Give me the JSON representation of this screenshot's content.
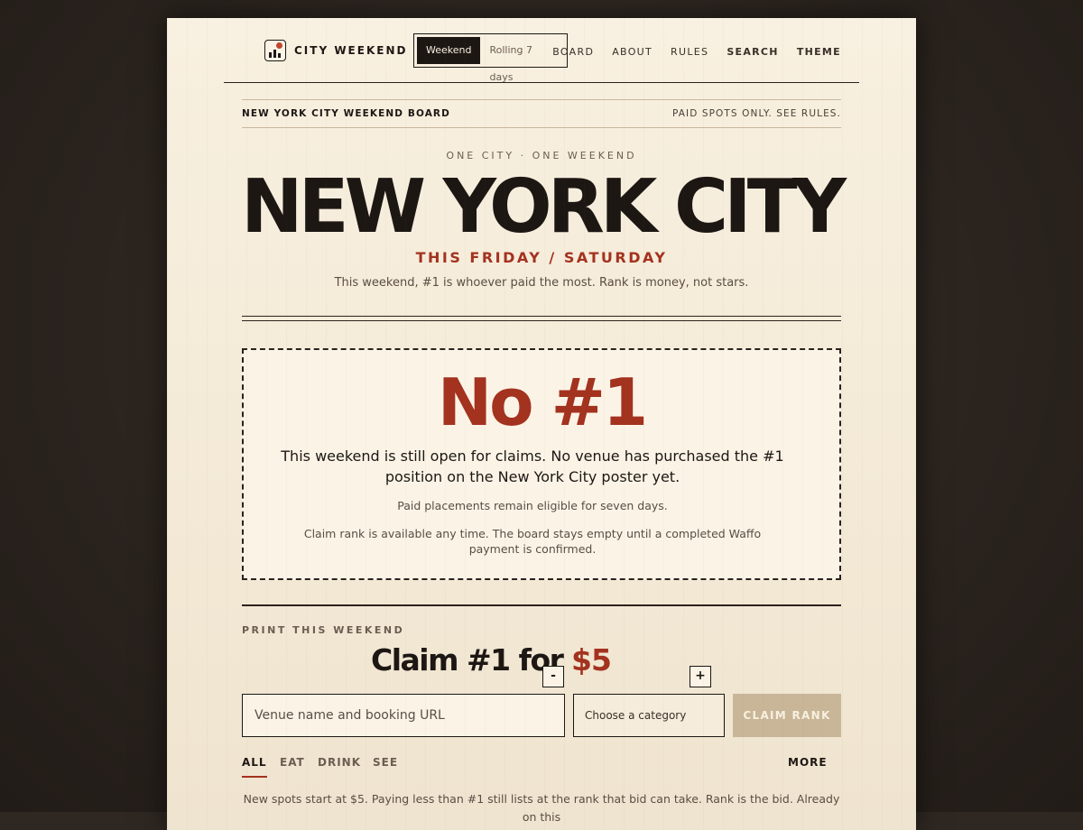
{
  "brand": {
    "name": "CITY WEEKEND",
    "logo_icon": "skyline-logo-icon"
  },
  "view_toggle": {
    "options": [
      "Weekend",
      "Rolling 7 days"
    ],
    "selected": "Weekend"
  },
  "nav": {
    "board": "BOARD",
    "about": "ABOUT",
    "rules": "RULES",
    "search": "SEARCH",
    "theme": "THEME"
  },
  "ribbon": {
    "left": "NEW YORK CITY WEEKEND BOARD",
    "right": "PAID SPOTS ONLY. SEE RULES."
  },
  "hero": {
    "kicker": "ONE CITY · ONE WEEKEND",
    "city": "NEW YORK CITY",
    "dates": "THIS FRIDAY / SATURDAY",
    "tagline": "This weekend, #1 is whoever paid the most. Rank is money, not stars."
  },
  "empty_state": {
    "headline": "No #1",
    "lead": "This weekend is still open for claims. No venue has purchased the #1 position on the New York City poster yet.",
    "note1": "Paid placements remain eligible for seven days.",
    "note2": "Claim rank is available any time. The board stays empty until a completed Waffo payment is confirmed."
  },
  "claim": {
    "section_label": "PRINT THIS WEEKEND",
    "prefix": "Claim #1 for",
    "minus": "-",
    "price": "$5",
    "plus": "+",
    "venue_placeholder": "Venue name and booking URL",
    "category_value": "Choose a category",
    "submit": "CLAIM RANK"
  },
  "tabs": {
    "all": "ALL",
    "eat": "EAT",
    "drink": "DRINK",
    "see": "SEE",
    "more": "MORE",
    "active": "ALL"
  },
  "footer_note": "New spots start at $5. Paying less than #1 still lists at the rank that bid can take. Rank is the bid. Already on this",
  "colors": {
    "accent": "#a3321f",
    "ink": "#1d1714",
    "paper": "#f8f0e0",
    "button_disabled": "#c9b698"
  }
}
